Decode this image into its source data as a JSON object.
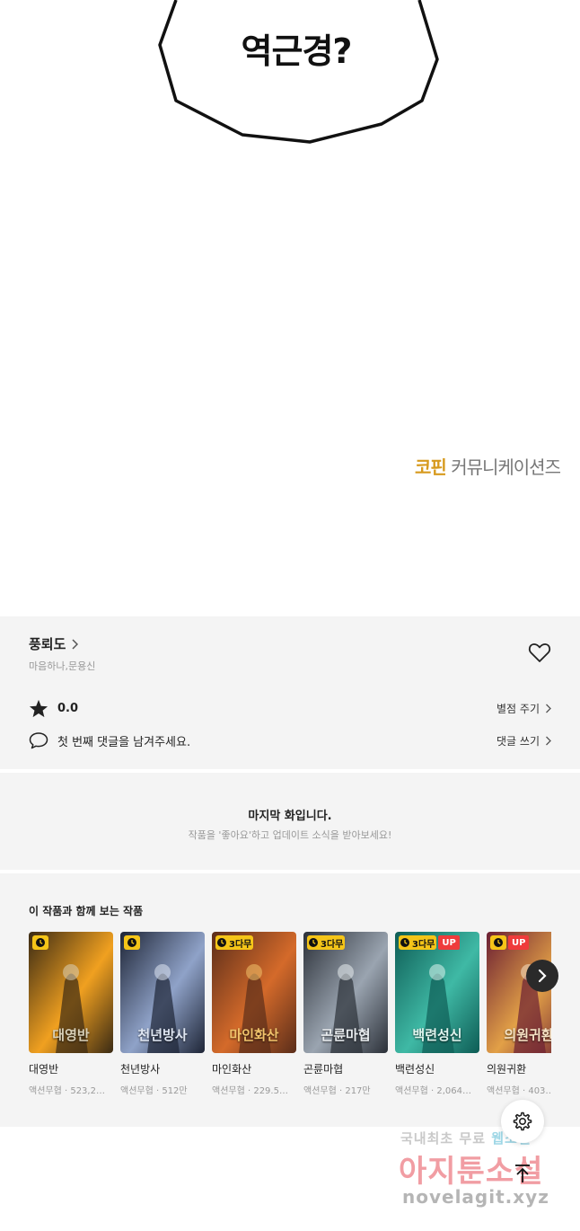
{
  "comic": {
    "bubble_text": "역근경?",
    "publisher_brand": "코핀",
    "publisher_rest": "커뮤니케이션즈"
  },
  "work": {
    "title": "풍뢰도",
    "authors": "마음하나,문용신",
    "rating": "0.0",
    "rate_label": "별점 주기",
    "comment_prompt": "첫 번째 댓글을 남겨주세요.",
    "comment_label": "댓글 쓰기",
    "icons": [
      "chevron-right-icon",
      "heart-icon",
      "star-icon",
      "speech-bubble-icon"
    ]
  },
  "end_notice": {
    "title": "마지막 화입니다.",
    "subtitle": "작품을 '좋아요'하고 업데이트 소식을 받아보세요!"
  },
  "recommendations": {
    "title": "이 작품과 함께 보는 작품",
    "items": [
      {
        "title": "대영반",
        "genre": "액션무협",
        "views": "523,2…",
        "badge_days": "",
        "up": false,
        "art_text": "대영반",
        "colors": [
          "#3a2a14",
          "#f0a020",
          "#d9d0b8"
        ]
      },
      {
        "title": "천년방사",
        "genre": "액션무협",
        "views": "512만",
        "badge_days": "",
        "up": false,
        "art_text": "천년방사",
        "colors": [
          "#1e2536",
          "#8fa2c8",
          "#dfe6f2"
        ]
      },
      {
        "title": "마인화산",
        "genre": "액션무협",
        "views": "229.5…",
        "badge_days": "3다무",
        "up": false,
        "art_text": "마인화산",
        "colors": [
          "#5a2d1a",
          "#d46a2a",
          "#f1c36b"
        ]
      },
      {
        "title": "곤륜마협",
        "genre": "액션무협",
        "views": "217만",
        "badge_days": "3다무",
        "up": false,
        "art_text": "곤륜마협",
        "colors": [
          "#2b3038",
          "#9aa4b0",
          "#e8ecef"
        ]
      },
      {
        "title": "백련성신",
        "genre": "액션무협",
        "views": "2,064…",
        "badge_days": "3다무",
        "up": true,
        "art_text": "백련성신",
        "colors": [
          "#0e5c55",
          "#3fb9a5",
          "#dff4ee"
        ]
      },
      {
        "title": "의원귀환",
        "genre": "액션무협",
        "views": "403…",
        "badge_days": "",
        "up": true,
        "art_text": "의원귀환",
        "colors": [
          "#6b1f33",
          "#e2a047",
          "#f6e2c4"
        ]
      }
    ],
    "next_icon": "chevron-right-icon",
    "up_label": "UP"
  },
  "floating": {
    "settings_icon": "gear-icon",
    "top_icon": "arrow-up-icon"
  },
  "watermark": {
    "line1_a": "국내최초 무료 ",
    "line1_b": "웹소설",
    "line2": "아지툰소설",
    "line3": "novelagit.xyz"
  }
}
